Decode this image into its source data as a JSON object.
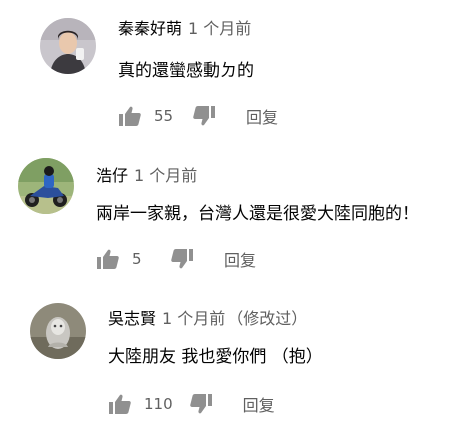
{
  "comments": [
    {
      "author": "秦秦好萌",
      "time": "1 个月前",
      "edited": "",
      "text": "真的還蠻感動ㄉ的",
      "likes": "55",
      "reply_label": "回复",
      "avatar_icon": "person-avatar-icon"
    },
    {
      "author": "浩仔",
      "time": "1 个月前",
      "edited": "",
      "text": "兩岸一家親，台灣人還是很愛大陸同胞的！",
      "likes": "5",
      "reply_label": "回复",
      "avatar_icon": "motorcycle-avatar-icon"
    },
    {
      "author": "吳志賢",
      "time": "1 个月前",
      "edited": "（修改过）",
      "text": "大陸朋友 我也愛你們 （抱）",
      "likes": "110",
      "reply_label": "回复",
      "avatar_icon": "figure-avatar-icon"
    }
  ]
}
